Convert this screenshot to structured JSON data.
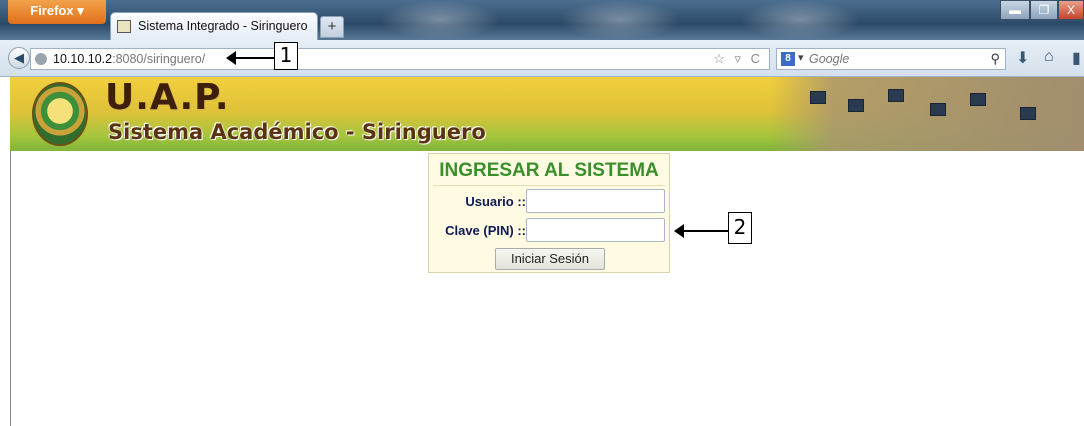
{
  "browser": {
    "app_button": "Firefox ▾",
    "tab_title": "Sistema Integrado - Siringuero",
    "new_tab": "+",
    "url_host": "10.10.10.2",
    "url_path": ":8080/siringuero/",
    "url_icons": "☆ ▿ C",
    "search_engine_icon": "8",
    "search_placeholder": "Google",
    "window_controls": {
      "min": "▬",
      "max": "❐",
      "close": "X"
    }
  },
  "annotations": {
    "callout1": "1",
    "callout2": "2"
  },
  "site": {
    "title": "U.A.P.",
    "subtitle": "Sistema Académico - Siringuero"
  },
  "login": {
    "heading": "INGRESAR AL SISTEMA",
    "user_label": "Usuario ::",
    "user_value": "",
    "pin_label": "Clave (PIN) ::",
    "pin_value": "",
    "submit_label": "Iniciar Sesión"
  },
  "colors": {
    "login_heading": "#3a8f2c",
    "label": "#0d1a55",
    "banner_yellow": "#f2cf3c",
    "banner_green": "#7fb33a"
  }
}
